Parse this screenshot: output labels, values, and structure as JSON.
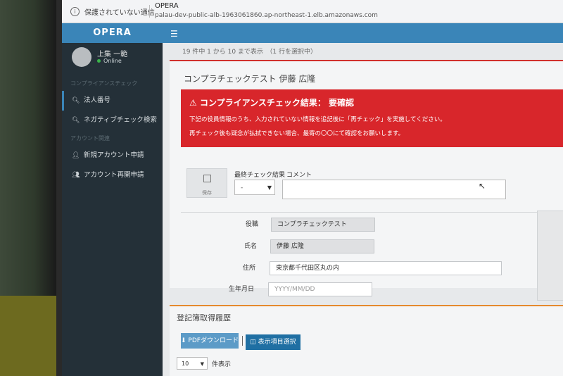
{
  "browser": {
    "security_warning": "保護されていない通信",
    "site_name": "OPERA",
    "url": "palau-dev-public-alb-1963061860.ap-northeast-1.elb.amazonaws.com"
  },
  "sidebar": {
    "brand": "OPERA",
    "user_name": "上集 一範",
    "user_status": "Online",
    "sections": [
      {
        "header": "コンプライアンスチェック",
        "items": [
          {
            "label": "法人番号",
            "icon": "search-icon",
            "active": true
          },
          {
            "label": "ネガティブチェック検索",
            "icon": "search-icon",
            "active": false
          }
        ]
      },
      {
        "header": "アカウント関連",
        "items": [
          {
            "label": "新規アカウント申請",
            "icon": "user-icon",
            "active": false
          },
          {
            "label": "アカウント再開申請",
            "icon": "users-icon",
            "active": false
          }
        ]
      }
    ]
  },
  "topnav": {
    "menu_icon": "hamburger-icon"
  },
  "main": {
    "pager_text": "19 件中 1 から 10 まで表示　（1 行を選択中）",
    "panel_title": "コンプラチェックテスト 伊藤 広隆",
    "alert": {
      "heading": "コンプライアンスチェック結果：  要確認",
      "line1": "下記の役員情報のうち、入力されていない情報を追記後に「再チェック」を実施してください。",
      "line2": "再チェック後も疑念が払拭できない場合、最寄の〇〇にて確認をお願いします。",
      "color": "#d8262b"
    },
    "save_label": "保存",
    "check_result_label": "最終チェック結果",
    "check_result_value": "-",
    "comment_label": "コメント",
    "fields": {
      "position_label": "役職",
      "position_value": "コンプラチェックテスト",
      "name_label": "氏名",
      "name_value": "伊藤 広隆",
      "address_label": "住所",
      "address_value": "東京都千代田区丸の内",
      "dob_label": "生年月日",
      "dob_placeholder": "YYYY/MM/DD"
    },
    "history": {
      "title": "登記簿取得履歴",
      "pdf_button": "PDFダウンロード",
      "columns_button": "表示項目選択",
      "page_size": "10",
      "page_size_label": "件表示"
    }
  },
  "colors": {
    "accent": "#3a85b8",
    "sidebar": "#243038",
    "alert": "#d8262b",
    "history_border": "#e58a2e"
  }
}
